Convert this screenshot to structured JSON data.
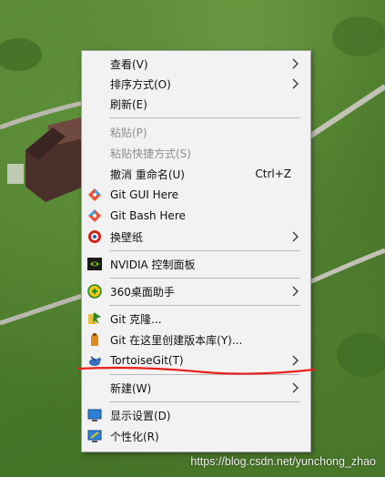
{
  "context_menu": {
    "items": [
      {
        "label": "查看(V)",
        "submenu": true,
        "icon": ""
      },
      {
        "label": "排序方式(O)",
        "submenu": true,
        "icon": ""
      },
      {
        "label": "刷新(E)",
        "icon": ""
      },
      {
        "label": "粘贴(P)",
        "disabled": true,
        "icon": ""
      },
      {
        "label": "粘贴快捷方式(S)",
        "disabled": true,
        "icon": ""
      },
      {
        "label": "撤消 重命名(U)",
        "shortcut": "Ctrl+Z",
        "icon": ""
      },
      {
        "label": "Git GUI Here",
        "icon": "git-gui-icon"
      },
      {
        "label": "Git Bash Here",
        "icon": "git-bash-icon"
      },
      {
        "label": "换壁纸",
        "submenu": true,
        "icon": "wallpaper-icon"
      },
      {
        "label": "NVIDIA 控制面板",
        "icon": "nvidia-icon"
      },
      {
        "label": "360桌面助手",
        "submenu": true,
        "icon": "360-desktop-icon"
      },
      {
        "label": "Git 克隆...",
        "icon": "tortoisegit-clone-icon"
      },
      {
        "label": "Git 在这里创建版本库(Y)...",
        "icon": "tortoisegit-create-repo-icon"
      },
      {
        "label": "TortoiseGit(T)",
        "submenu": true,
        "icon": "tortoisegit-icon"
      },
      {
        "label": "新建(W)",
        "submenu": true,
        "icon": ""
      },
      {
        "label": "显示设置(D)",
        "icon": "display-settings-icon"
      },
      {
        "label": "个性化(R)",
        "icon": "personalize-icon"
      }
    ]
  },
  "watermark": "https://blog.csdn.net/yunchong_zhao",
  "colors": {
    "menu_bg": "#f2f2f2",
    "separator": "#b9b9b9",
    "disabled_text": "#8f8f8f",
    "annotation_red": "#e8201c"
  }
}
